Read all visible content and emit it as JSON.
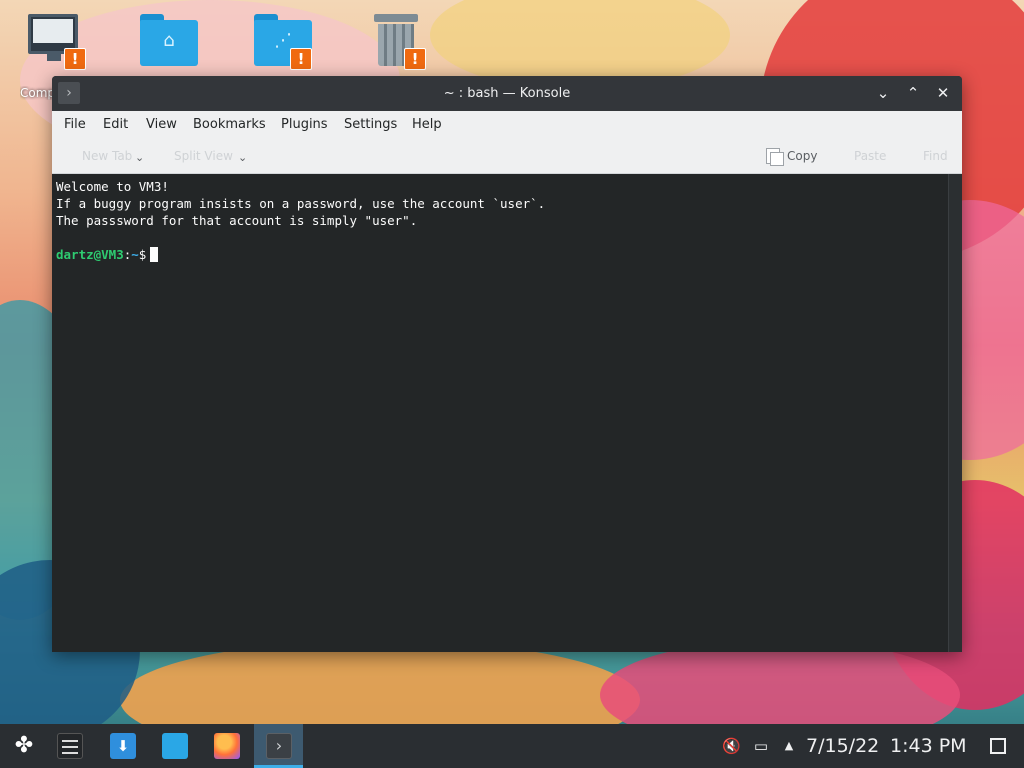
{
  "desktop": {
    "icons": [
      {
        "name": "computer",
        "label": "Computer"
      },
      {
        "name": "home-folder",
        "label": ""
      },
      {
        "name": "shared-folder",
        "label": ""
      },
      {
        "name": "trash",
        "label": ""
      }
    ],
    "warning_glyph": "!"
  },
  "window": {
    "title": "~ : bash — Konsole",
    "app_icon_glyph": "›",
    "controls": {
      "minimize": "⌄",
      "maximize": "⌃",
      "close": "✕"
    }
  },
  "menubar": {
    "items": [
      "File",
      "Edit",
      "View",
      "Bookmarks",
      "Plugins",
      "Settings",
      "Help"
    ]
  },
  "toolbar": {
    "new_tab": "New Tab",
    "split_view": "Split View",
    "copy": "Copy",
    "paste": "Paste",
    "find": "Find"
  },
  "terminal": {
    "lines": [
      "Welcome to VM3!",
      "If a buggy program insists on a password, use the account `user`.",
      "The passsword for that account is simply \"user\"."
    ],
    "prompt_user": "dartz@VM3",
    "prompt_sep": ":",
    "prompt_path": "~",
    "prompt_symbol": "$"
  },
  "taskbar": {
    "launcher_glyph": "✤",
    "store_glyph": "⬇",
    "konsole_glyph": "›",
    "date": "7/15/22",
    "time": "1:43 PM",
    "tray": {
      "volume": "🔇",
      "network": "▭",
      "expand": "▲"
    }
  },
  "colors": {
    "terminal_bg": "#232627",
    "prompt_user": "#2ecc71",
    "accent": "#3daee9"
  }
}
